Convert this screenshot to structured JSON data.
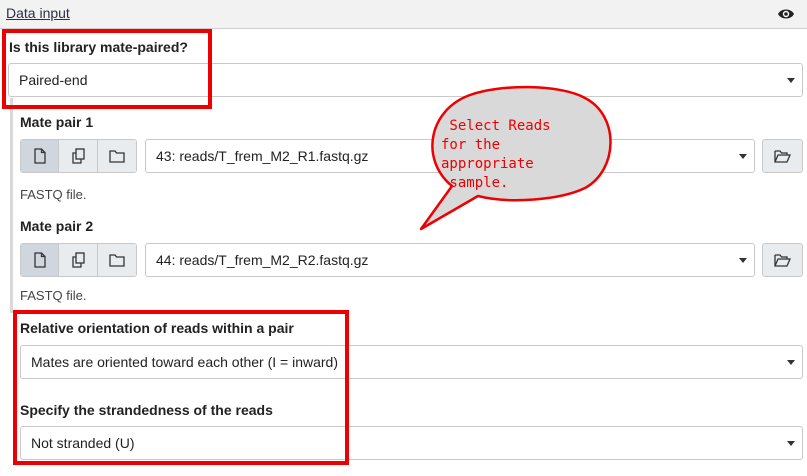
{
  "header": {
    "title": "Data input",
    "visibility_icon": "eye-icon"
  },
  "library": {
    "label": "Is this library mate-paired?",
    "value": "Paired-end"
  },
  "mate_pair_1": {
    "label": "Mate pair 1",
    "value": "43: reads/T_frem_M2_R1.fastq.gz",
    "help": "FASTQ file."
  },
  "mate_pair_2": {
    "label": "Mate pair 2",
    "value": "44: reads/T_frem_M2_R2.fastq.gz",
    "help": "FASTQ file."
  },
  "orientation": {
    "label": "Relative orientation of reads within a pair",
    "value": "Mates are oriented toward each other (I = inward)"
  },
  "strandedness": {
    "label": "Specify the strandedness of the reads",
    "value": "Not stranded (U)"
  },
  "callout": {
    "line1": " Select Reads",
    "line2": "for the",
    "line3": "appropriate",
    "line4": " sample."
  },
  "colors": {
    "highlight": "#ee0000",
    "callout_fill": "#d9d9d9",
    "header_bg": "#f2f2f2"
  },
  "icons": {
    "single_dataset": "file-icon",
    "multiple_datasets": "copy-icon",
    "collection": "folder-icon",
    "browse": "folder-open-icon"
  }
}
